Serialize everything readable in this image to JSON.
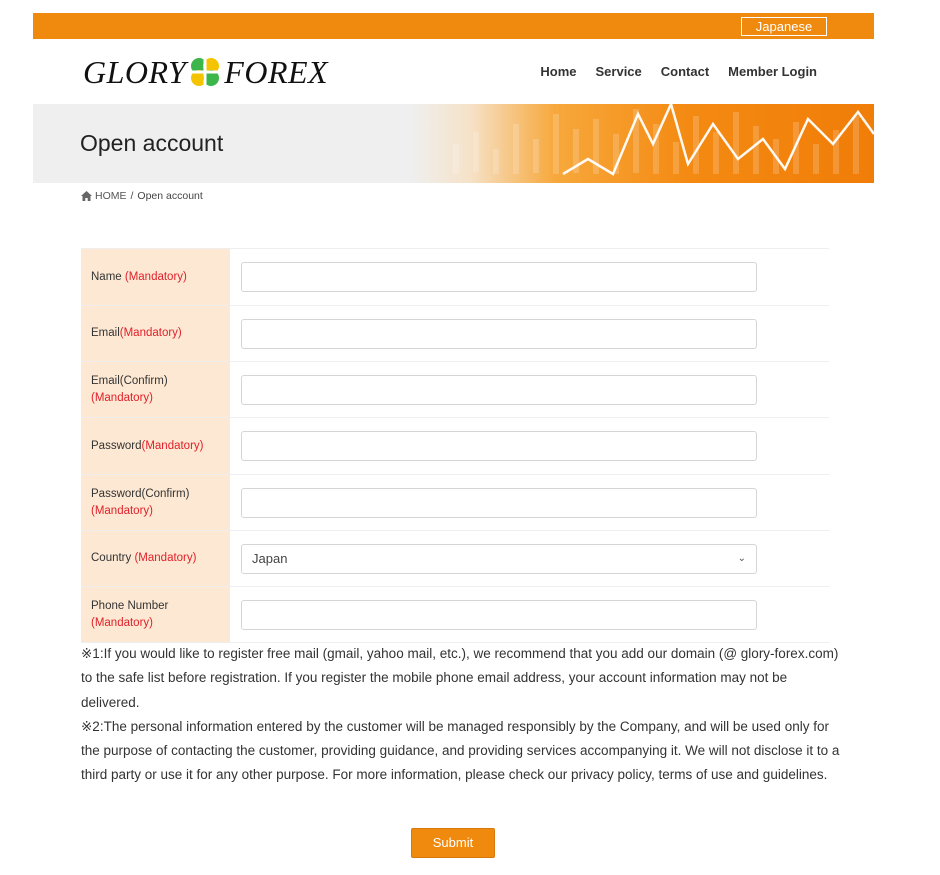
{
  "topbar": {
    "language_button": "Japanese"
  },
  "header": {
    "logo_left": "GLORY",
    "logo_right": "FOREX",
    "nav": [
      "Home",
      "Service",
      "Contact",
      "Member Login"
    ]
  },
  "banner": {
    "title": "Open account"
  },
  "breadcrumb": {
    "home": "HOME",
    "separator": "/",
    "current": "Open account"
  },
  "form": {
    "rows": [
      {
        "label": "Name ",
        "mandatory": "(Mandatory)",
        "type": "text",
        "value": ""
      },
      {
        "label": "Email",
        "mandatory": "(Mandatory)",
        "type": "email",
        "value": ""
      },
      {
        "label": "Email(Confirm)",
        "mandatory": "(Mandatory)",
        "type": "email",
        "value": ""
      },
      {
        "label": "Password",
        "mandatory": "(Mandatory)",
        "type": "password",
        "value": ""
      },
      {
        "label": "Password(Confirm)",
        "mandatory": "(Mandatory)",
        "type": "password",
        "value": ""
      },
      {
        "label": "Country ",
        "mandatory": "(Mandatory)",
        "type": "select",
        "value": "Japan"
      },
      {
        "label": "Phone Number",
        "mandatory": "(Mandatory)",
        "type": "tel",
        "value": ""
      }
    ]
  },
  "notes": {
    "note1": "※1:If you would like to register free mail (gmail, yahoo mail, etc.), we recommend that you add our domain (@ glory-forex.com) to the safe list before registration. If you register the mobile phone email address, your account information may not be delivered.",
    "note2": "※2:The personal information entered by the customer will be managed responsibly by the Company, and will be used only for the purpose of contacting the customer, providing guidance, and providing services accompanying it. We will not disclose it to a third party or use it for any other purpose. For more information, please check our privacy policy, terms of use and guidelines."
  },
  "submit_label": "Submit",
  "colors": {
    "accent": "#f08a0f",
    "label_bg": "#fde9d3",
    "mandatory": "#e0202a",
    "logo_green": "#3cb54a",
    "logo_yellow": "#f5c400"
  },
  "icons": {
    "breadcrumb_home": "home-icon",
    "country_select": "chevron-down-icon",
    "logo_mark": "clover-icon"
  }
}
